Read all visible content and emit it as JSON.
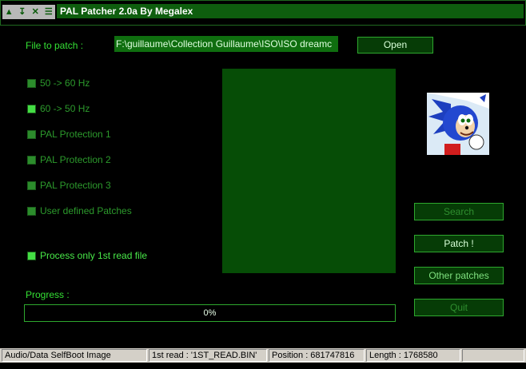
{
  "window": {
    "title": "PAL Patcher 2.0a By Megalex",
    "controls": [
      "restore",
      "minimize",
      "close",
      "menu"
    ]
  },
  "file": {
    "label": "File to patch :",
    "path": "F:\\guillaume\\Collection Guillaume\\ISO\\ISO dreamc",
    "open_label": "Open"
  },
  "options": [
    {
      "label": "50 -> 60 Hz",
      "checked": false
    },
    {
      "label": "60 -> 50 Hz",
      "checked": true
    },
    {
      "label": "PAL Protection 1",
      "checked": false
    },
    {
      "label": "PAL Protection 2",
      "checked": false
    },
    {
      "label": "PAL Protection 3",
      "checked": false
    },
    {
      "label": "User defined Patches",
      "checked": false
    },
    {
      "label": "Process only 1st read file",
      "checked": true
    }
  ],
  "buttons": {
    "search": "Search",
    "patch": "Patch !",
    "other": "Other patches",
    "quit": "Quit"
  },
  "progress": {
    "label": "Progress :",
    "value": 0,
    "text": "0%"
  },
  "status": {
    "image_type": "Audio/Data SelfBoot Image",
    "first_read": "1st read : '1ST_READ.BIN'",
    "position": "Position : 681747816",
    "length": "Length : 1768580"
  },
  "colors": {
    "background": "#000000",
    "accent": "#0e5e0e",
    "text_green": "#34e034"
  }
}
